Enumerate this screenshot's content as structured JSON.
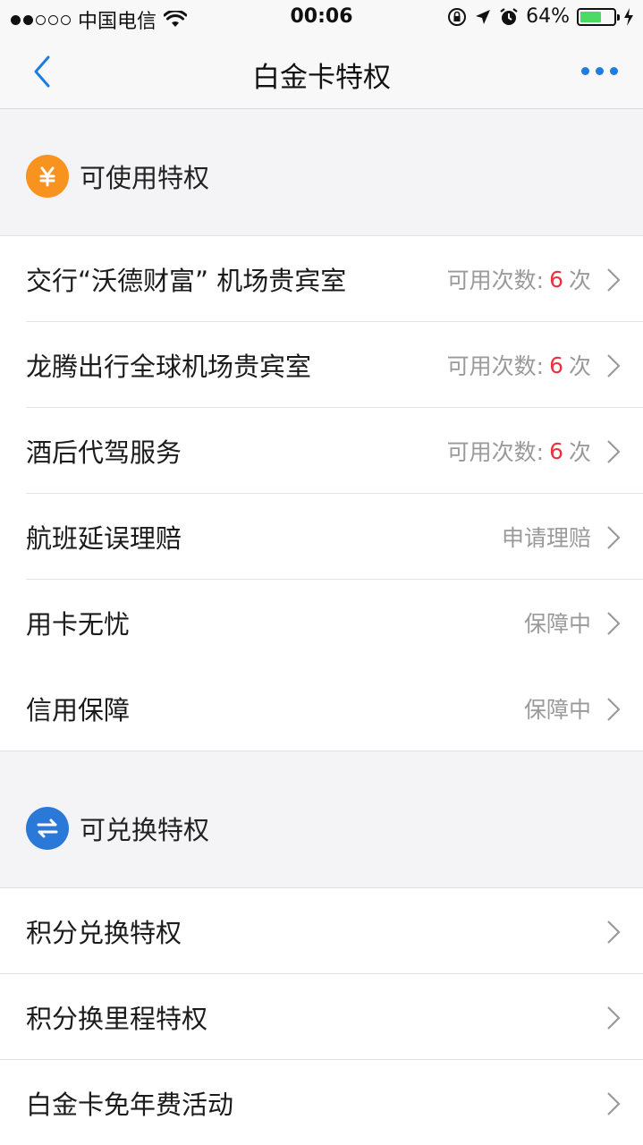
{
  "status_bar": {
    "carrier": "中国电信",
    "time": "00:06",
    "battery": "64%",
    "battery_level": 0.64
  },
  "nav": {
    "title": "白金卡特权",
    "back_icon": "chevron-left-icon",
    "more_icon": "more-dots-icon"
  },
  "sections": [
    {
      "label": "可使用特权",
      "icon": "yuan-coin-icon",
      "icon_color": "#f7931e",
      "items": [
        {
          "title": "交行“沃德财富” 机场贵宾室",
          "status_prefix": "可用次数:",
          "count": "6",
          "status_suffix": "次"
        },
        {
          "title": "龙腾出行全球机场贵宾室",
          "status_prefix": "可用次数:",
          "count": "6",
          "status_suffix": "次"
        },
        {
          "title": "酒后代驾服务",
          "status_prefix": "可用次数:",
          "count": "6",
          "status_suffix": "次"
        },
        {
          "title": "航班延误理赔",
          "status": "申请理赔"
        },
        {
          "title": "用卡无忧",
          "status": "保障中"
        },
        {
          "title": "信用保障",
          "status": "保障中"
        }
      ]
    },
    {
      "label": "可兑换特权",
      "icon": "exchange-arrows-icon",
      "icon_color": "#2a79d8",
      "items": [
        {
          "title": "积分兑换特权"
        },
        {
          "title": "积分换里程特权"
        },
        {
          "title": "白金卡免年费活动"
        }
      ]
    }
  ],
  "colors": {
    "accent_blue": "#1f7ce0",
    "count_red": "#e8333c"
  }
}
